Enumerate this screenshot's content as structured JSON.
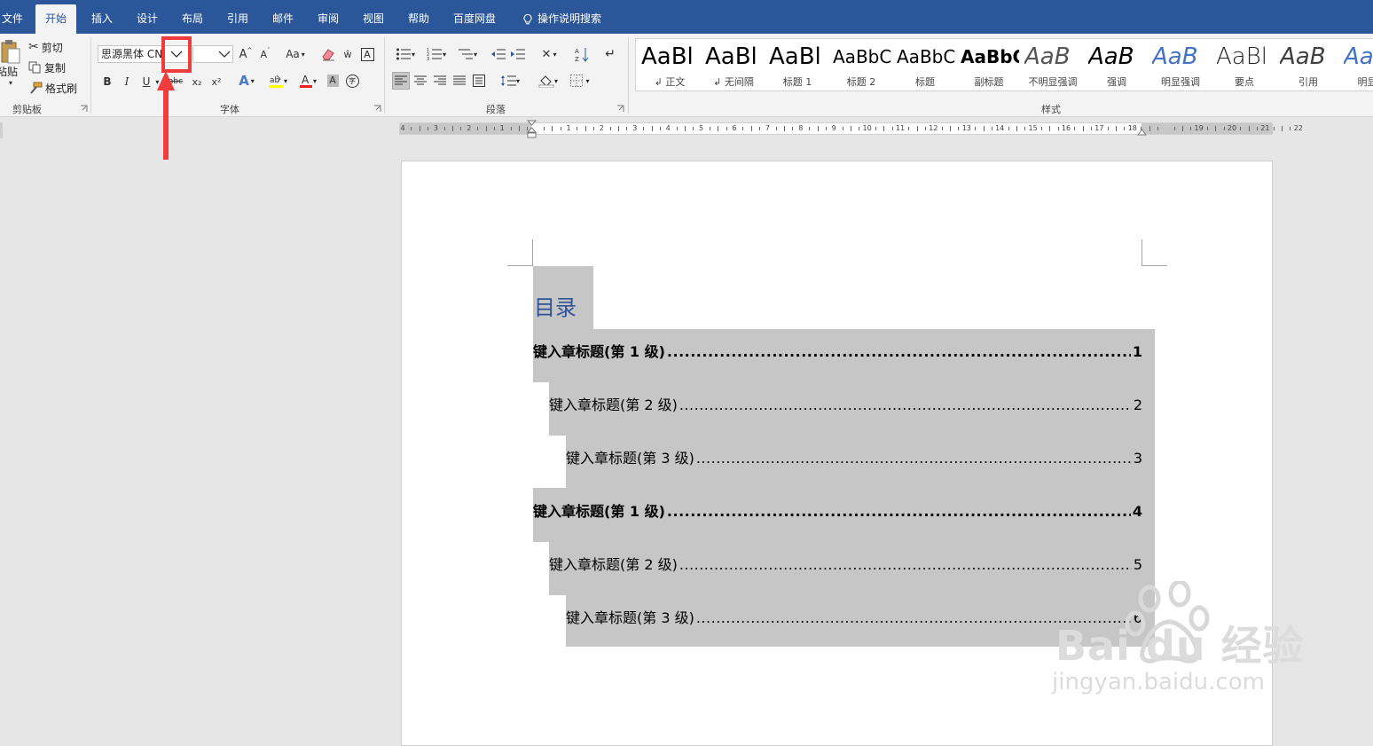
{
  "tabs": [
    "文件",
    "开始",
    "插入",
    "设计",
    "布局",
    "引用",
    "邮件",
    "审阅",
    "视图",
    "帮助",
    "百度网盘"
  ],
  "active_tab": "开始",
  "tell_me": "操作说明搜索",
  "clipboard": {
    "paste": "粘贴",
    "cut": "剪切",
    "copy": "复制",
    "format_painter": "格式刷",
    "group_label": "剪贴板"
  },
  "font": {
    "font_name": "思源黑体 CN",
    "font_size": "",
    "grow": "A",
    "shrink": "A",
    "change_case": "Aa",
    "bold": "B",
    "italic": "I",
    "underline": "U",
    "strike": "abc",
    "subscript": "x₂",
    "superscript": "x²",
    "group_label": "字体"
  },
  "paragraph": {
    "group_label": "段落"
  },
  "styles": {
    "group_label": "样式",
    "items": [
      {
        "sample": "AaBl",
        "name": "↲ 正文"
      },
      {
        "sample": "AaBl",
        "name": "↲ 无间隔"
      },
      {
        "sample": "AaBl",
        "name": "标题 1"
      },
      {
        "sample": "AaBbC",
        "name": "标题 2"
      },
      {
        "sample": "AaBbC",
        "name": "标题"
      },
      {
        "sample": "AaBbC",
        "name": "副标题"
      },
      {
        "sample": "AaB",
        "name": "不明显强调"
      },
      {
        "sample": "AaB",
        "name": "强调"
      },
      {
        "sample": "AaB",
        "name": "明显强调"
      },
      {
        "sample": "AaBl",
        "name": "要点"
      },
      {
        "sample": "AaB",
        "name": "引用"
      },
      {
        "sample": "Aa",
        "name": "明显引"
      }
    ]
  },
  "ruler": {
    "labels": [
      "4",
      "3",
      "2",
      "1",
      "",
      "1",
      "2",
      "3",
      "4",
      "5",
      "6",
      "7",
      "8",
      "9",
      "10",
      "11",
      "12",
      "13",
      "14",
      "15",
      "16",
      "17",
      "18",
      "",
      "19",
      "20",
      "21",
      "22"
    ]
  },
  "document": {
    "toc_heading": "目录",
    "entries": [
      {
        "level": 1,
        "text": "键入章标题(第 1 级)",
        "page": "1"
      },
      {
        "level": 2,
        "text": "键入章标题(第 2 级)",
        "page": "2"
      },
      {
        "level": 3,
        "text": "键入章标题(第 3 级)",
        "page": "3"
      },
      {
        "level": 1,
        "text": "键入章标题(第 1 级)",
        "page": "4"
      },
      {
        "level": 2,
        "text": "键入章标题(第 2 级)",
        "page": "5"
      },
      {
        "level": 3,
        "text": "键入章标题(第 3 级)",
        "page": "6"
      }
    ]
  },
  "watermark": {
    "brand": "Bai du 经验",
    "url": "jingyan.baidu.com"
  },
  "colors": {
    "titlebar": "#2b579a",
    "ribbon": "#f3f3f3",
    "selection": "#c6c6c6",
    "heading": "#2f5496",
    "annotation": "#f03c3c",
    "style_accent": "#4472c4"
  }
}
